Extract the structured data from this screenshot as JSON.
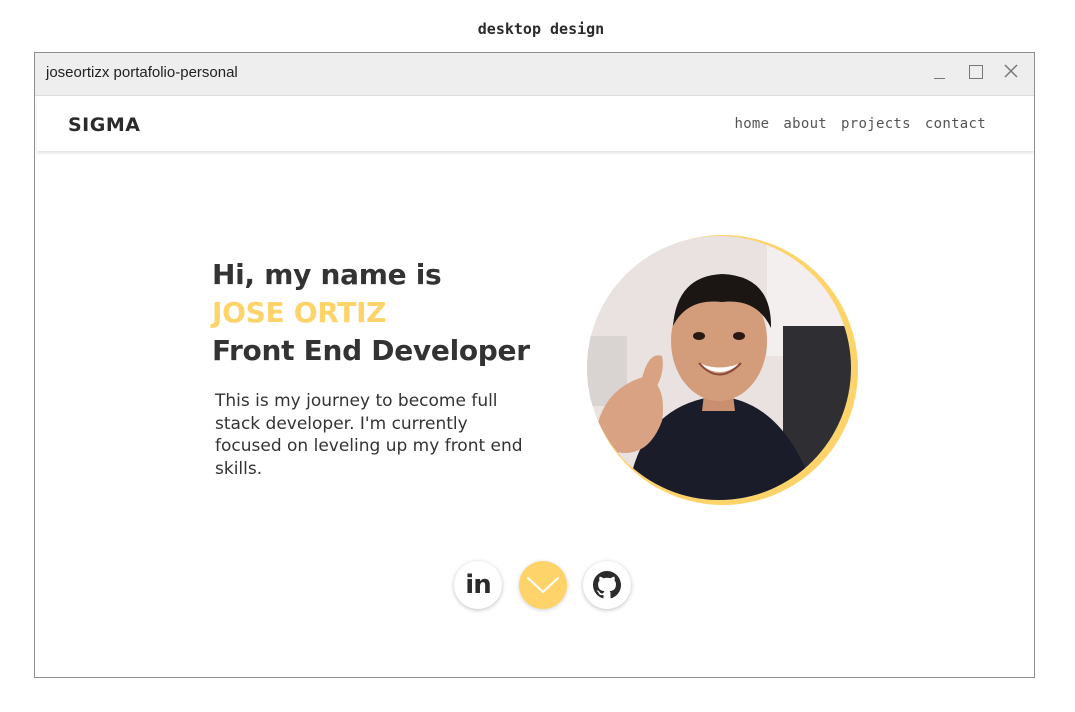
{
  "caption": "desktop design",
  "window": {
    "title": "joseortizx portafolio-personal",
    "controls": {
      "minimize_icon": "minimize-icon",
      "maximize_icon": "maximize-icon",
      "close_icon": "close-icon"
    }
  },
  "navbar": {
    "brand": "SIGMA",
    "links": [
      {
        "label": "home"
      },
      {
        "label": "about"
      },
      {
        "label": "projects"
      },
      {
        "label": "contact"
      }
    ]
  },
  "hero": {
    "greeting": "Hi, my name is",
    "name": "JOSE ORTIZ",
    "role": "Front End Developer",
    "intro": "This is my journey to become full stack developer. I'm currently focused on leveling up my front end skills.",
    "photo_icon": "profile-photo"
  },
  "social": {
    "linkedin_glyph": "in",
    "linkedin_icon": "linkedin-icon",
    "scroll_icon": "chevron-down-icon",
    "github_icon": "github-icon"
  },
  "colors": {
    "accent": "#fdd36a",
    "text": "#333333",
    "titlebar": "#eeeeee",
    "window_border": "#8e8e8e"
  }
}
